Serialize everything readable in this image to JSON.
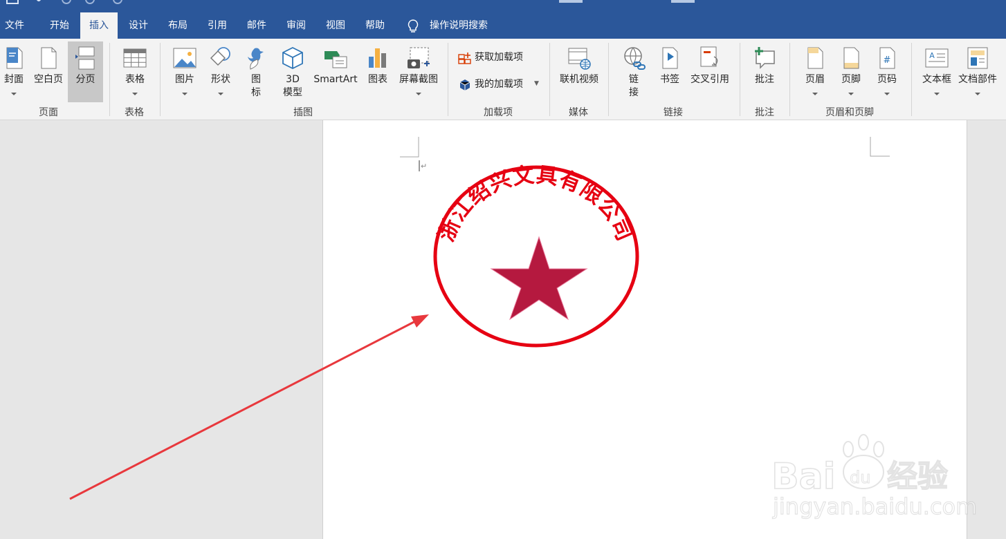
{
  "tabs": [
    {
      "label": "文件"
    },
    {
      "label": "开始"
    },
    {
      "label": "插入"
    },
    {
      "label": "设计"
    },
    {
      "label": "布局"
    },
    {
      "label": "引用"
    },
    {
      "label": "邮件"
    },
    {
      "label": "审阅"
    },
    {
      "label": "视图"
    },
    {
      "label": "帮助"
    }
  ],
  "tell_me": "操作说明搜索",
  "ribbon": {
    "pages": {
      "cover": "封面",
      "blank_page": "空白页",
      "page_break": "分页",
      "group": "页面"
    },
    "tables": {
      "table": "表格",
      "group": "表格"
    },
    "illustrations": {
      "pictures": "图片",
      "shapes": "形状",
      "icons_line1": "图",
      "icons_line2": "标",
      "model3d_line1": "3D",
      "model3d_line2": "模型",
      "smartart": "SmartArt",
      "chart": "图表",
      "screenshot": "屏幕截图",
      "group": "插图"
    },
    "addins": {
      "get_addins": "获取加载项",
      "my_addins": "我的加载项",
      "group": "加载项"
    },
    "media": {
      "online_video": "联机视频",
      "group": "媒体"
    },
    "links": {
      "link_line1": "链",
      "link_line2": "接",
      "bookmark": "书签",
      "cross_reference": "交叉引用",
      "group": "链接"
    },
    "comments": {
      "comment": "批注",
      "group": "批注"
    },
    "header_footer": {
      "header": "页眉",
      "footer": "页脚",
      "page_number": "页码",
      "group": "页眉和页脚"
    },
    "text": {
      "text_box": "文本框",
      "quick_parts": "文档部件"
    }
  },
  "document": {
    "seal_text": "浙江绍兴文具有限公司",
    "seal_color": "#e60012",
    "star_color": "#b5193f"
  },
  "annotation": {
    "arrow_color": "#e8383d"
  },
  "colors": {
    "ribbon_blue": "#2b579a"
  }
}
